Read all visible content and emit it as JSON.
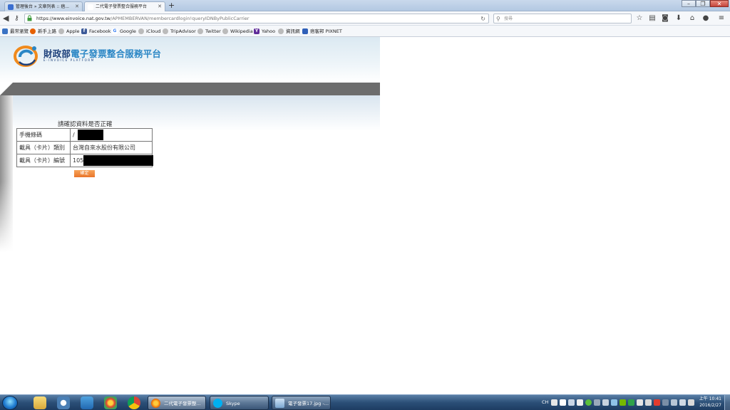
{
  "browser": {
    "tabs": [
      {
        "label": "管理後台 » 文章列表 :: 痞...",
        "active": false
      },
      {
        "label": "二代電子發票整合服務平台",
        "active": true
      }
    ],
    "new_tab": "+",
    "url_host": "https://www.einvoice.nat.gov.tw",
    "url_path": "/APMEMBERVAN/membercardlogin!queryIDNByPublicCarrier",
    "search_placeholder": "搜尋",
    "bookmarks": [
      "最常瀏覽",
      "新手上路",
      "Apple",
      "Facebook",
      "Google",
      "iCloud",
      "TripAdvisor",
      "Twitter",
      "Wikipedia",
      "Yahoo",
      "資訊網",
      "痞客邦 PIXNET"
    ]
  },
  "site": {
    "title_black": "財政部",
    "title_blue": "電子發票整合服務平台",
    "subtitle": "E-INVOICE PLATFORM"
  },
  "form": {
    "heading": "請確認資料是否正確",
    "rows": [
      {
        "label": "手機條碼",
        "value": "/"
      },
      {
        "label": "載具（卡片）類別",
        "value": "台灣自來水股份有限公司"
      },
      {
        "label": "載具（卡片）編號",
        "value": "105"
      }
    ],
    "confirm_button": "確定"
  },
  "taskbar": {
    "tasks": [
      {
        "label": "二代電子發票整...",
        "active": true
      },
      {
        "label": "Skype",
        "active": false
      },
      {
        "label": "電子發票17.jpg -...",
        "active": false
      }
    ],
    "language": "CH",
    "time": "上午 10:41",
    "date": "2016/2/27"
  },
  "colors": {
    "brand_blue": "#1c3f7a",
    "brand_light_blue": "#2a86c5",
    "header_bar": "#6d6d6d",
    "button_orange": "#e9752a"
  }
}
